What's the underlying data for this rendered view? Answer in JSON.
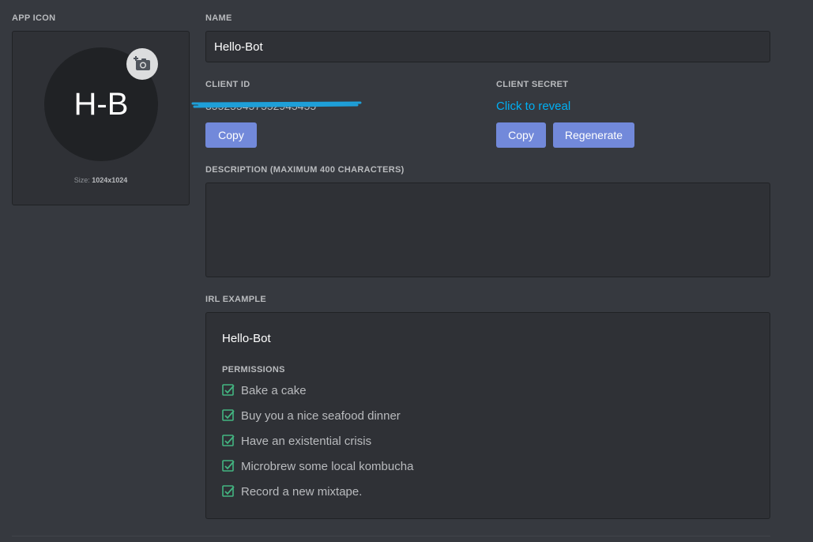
{
  "app_icon": {
    "label": "APP ICON",
    "initials": "H-B",
    "size_prefix": "Size:",
    "size_value": "1024x1024"
  },
  "name": {
    "label": "NAME",
    "value": "Hello-Bot"
  },
  "client_id": {
    "label": "CLIENT ID",
    "value": "355255457552945455",
    "copy_label": "Copy"
  },
  "client_secret": {
    "label": "CLIENT SECRET",
    "reveal_label": "Click to reveal",
    "copy_label": "Copy",
    "regenerate_label": "Regenerate"
  },
  "description": {
    "label": "DESCRIPTION (MAXIMUM 400 CHARACTERS)",
    "value": ""
  },
  "irl_example": {
    "label": "IRL EXAMPLE",
    "bot_name": "Hello-Bot",
    "permissions_label": "PERMISSIONS",
    "permissions": [
      "Bake a cake",
      "Buy you a nice seafood dinner",
      "Have an existential crisis",
      "Microbrew some local kombucha",
      "Record a new mixtape."
    ]
  },
  "colors": {
    "background": "#36393f",
    "accent": "#7289da",
    "link": "#00b0f4",
    "check": "#43b581",
    "redaction": "#1e9fd8"
  }
}
